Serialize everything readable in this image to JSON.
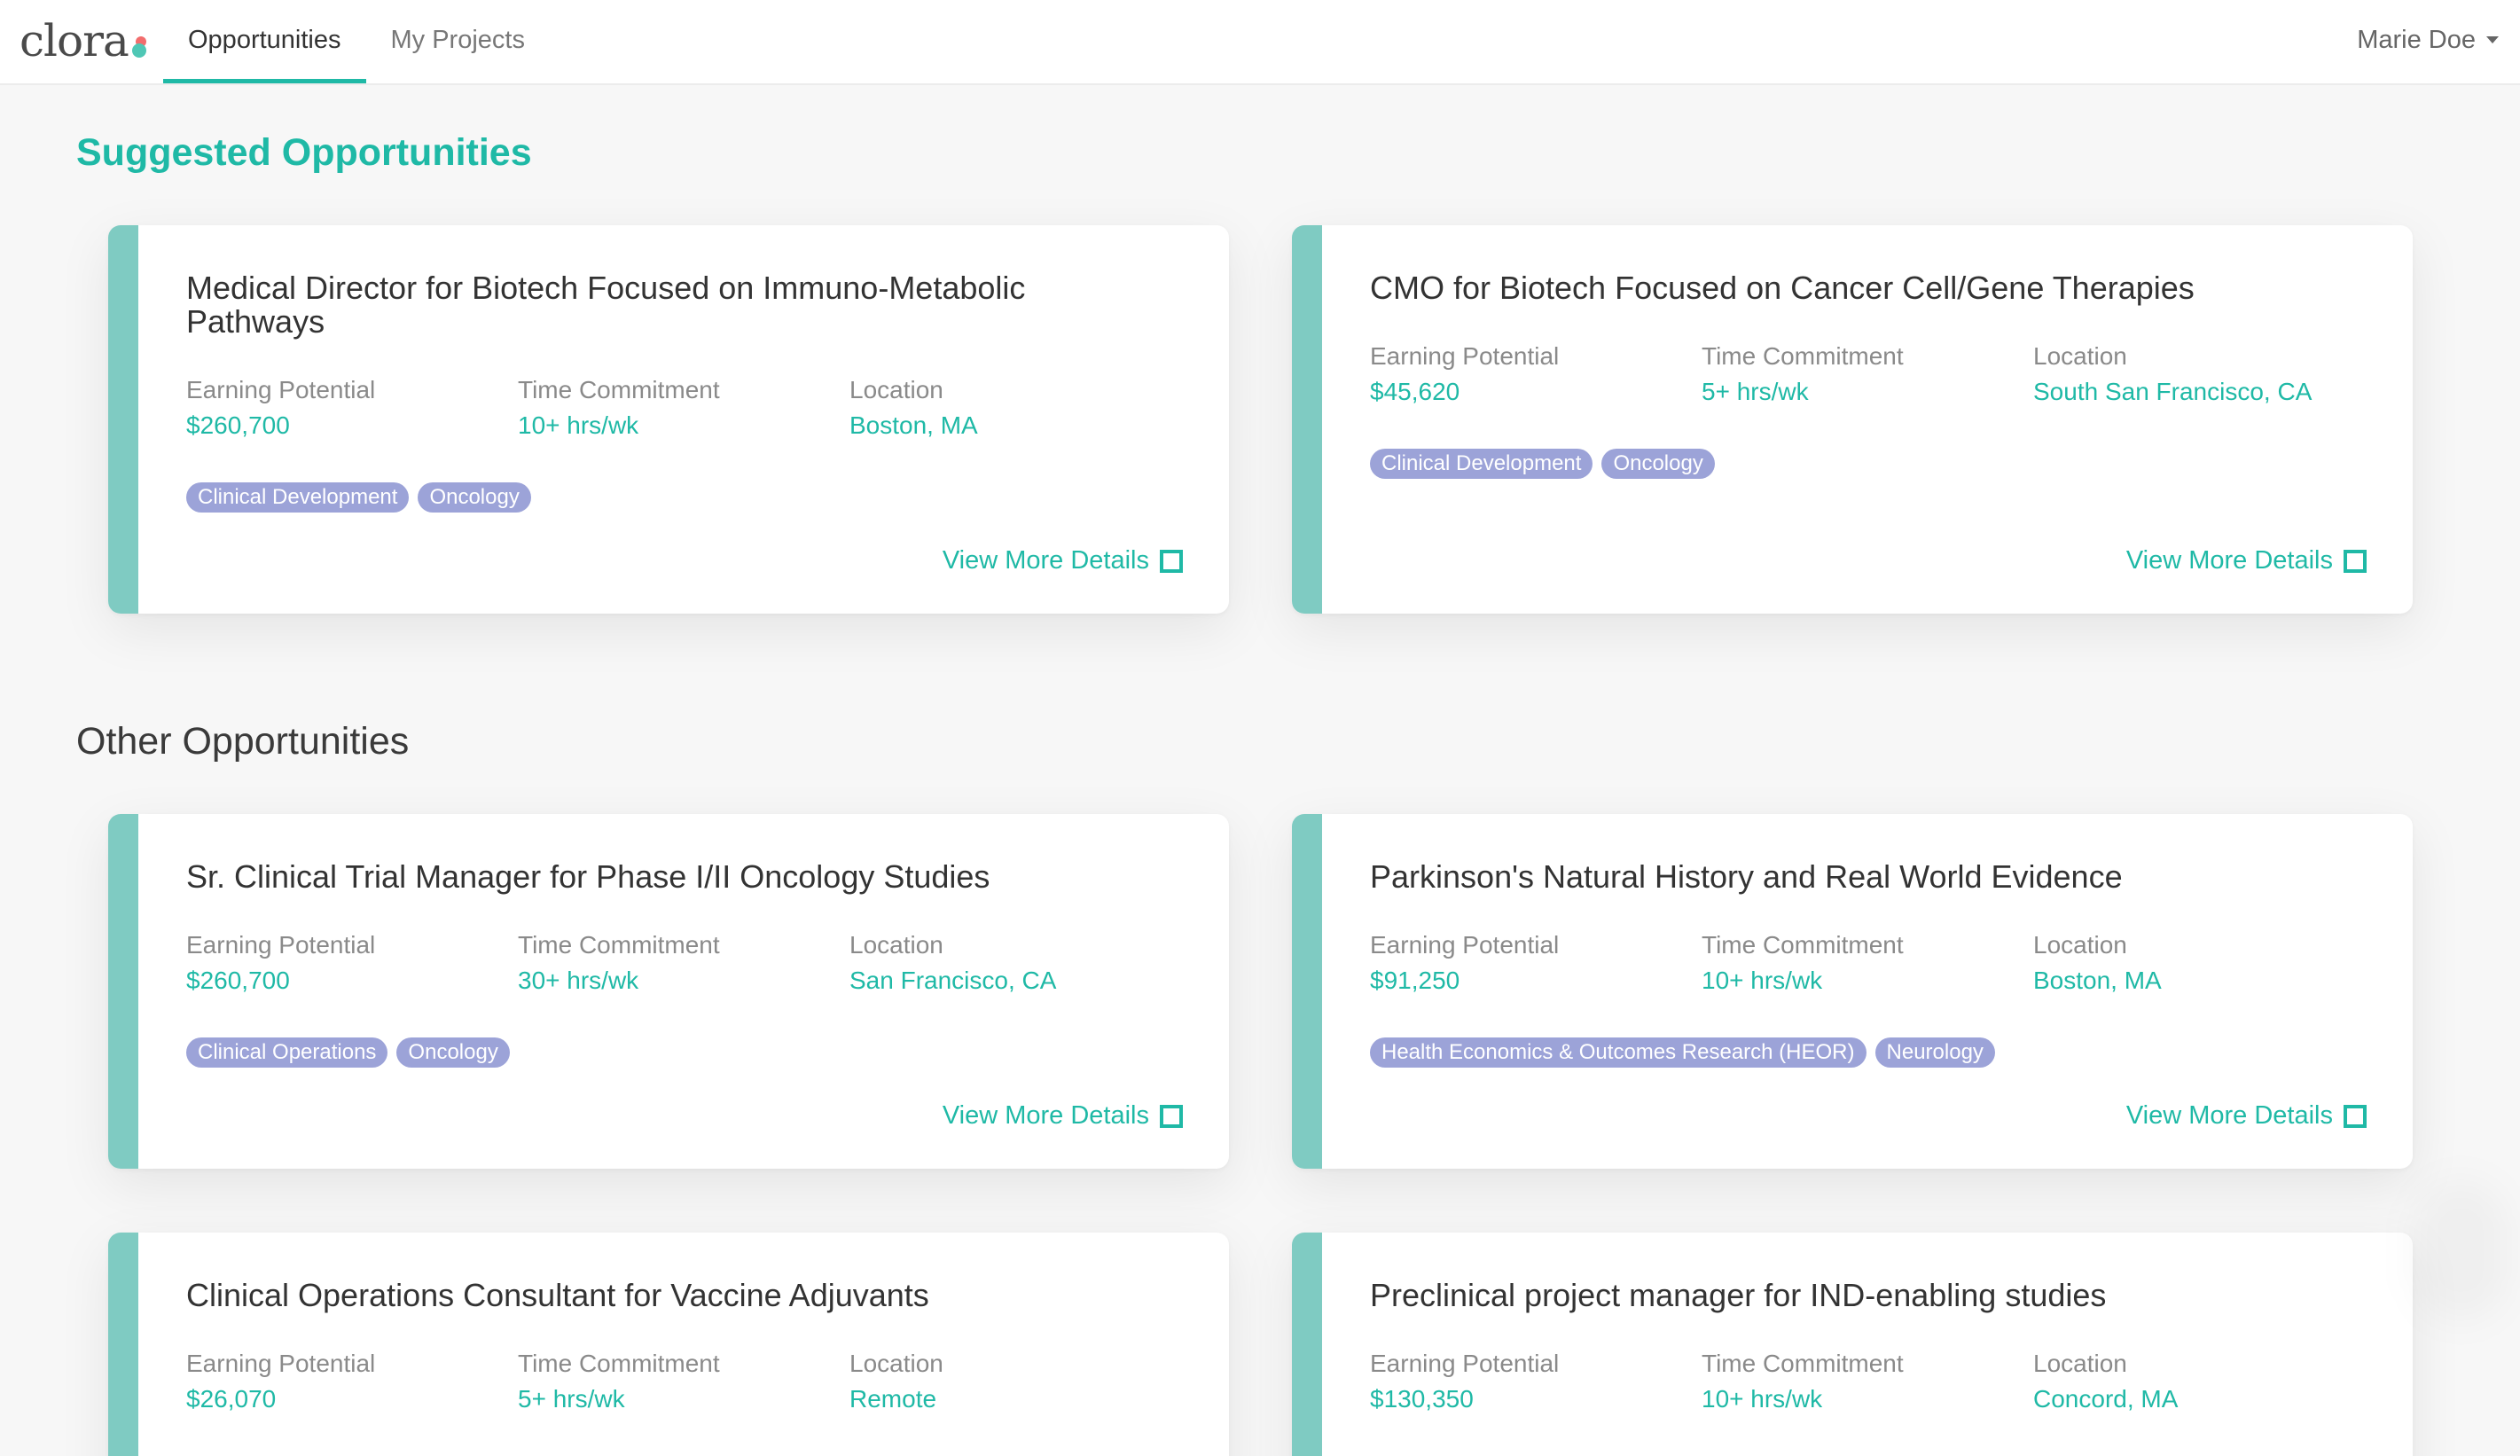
{
  "header": {
    "logo_text": "clora",
    "tabs": [
      {
        "label": "Opportunities",
        "active": true
      },
      {
        "label": "My Projects",
        "active": false
      }
    ],
    "user_name": "Marie Doe"
  },
  "suggested": {
    "title": "Suggested Opportunities",
    "cards": [
      {
        "title": "Medical Director for Biotech Focused on Immuno-Metabolic Pathways",
        "earning_label": "Earning Potential",
        "earning": "$260,700",
        "time_label": "Time Commitment",
        "time": "10+ hrs/wk",
        "location_label": "Location",
        "location": "Boston, MA",
        "tags": [
          "Clinical Development",
          "Oncology"
        ],
        "details_label": "View More Details"
      },
      {
        "title": "CMO for Biotech Focused on Cancer Cell/Gene Therapies",
        "earning_label": "Earning Potential",
        "earning": "$45,620",
        "time_label": "Time Commitment",
        "time": "5+ hrs/wk",
        "location_label": "Location",
        "location": "South San Francisco, CA",
        "tags": [
          "Clinical Development",
          "Oncology"
        ],
        "details_label": "View More Details"
      }
    ]
  },
  "other": {
    "title": "Other Opportunities",
    "cards": [
      {
        "title": "Sr. Clinical Trial Manager for Phase I/II Oncology Studies",
        "earning_label": "Earning Potential",
        "earning": "$260,700",
        "time_label": "Time Commitment",
        "time": "30+ hrs/wk",
        "location_label": "Location",
        "location": "San Francisco, CA",
        "tags": [
          "Clinical Operations",
          "Oncology"
        ],
        "details_label": "View More Details"
      },
      {
        "title": "Parkinson's Natural History and Real World Evidence",
        "earning_label": "Earning Potential",
        "earning": "$91,250",
        "time_label": "Time Commitment",
        "time": "10+ hrs/wk",
        "location_label": "Location",
        "location": "Boston, MA",
        "tags": [
          "Health Economics & Outcomes Research (HEOR)",
          "Neurology"
        ],
        "details_label": "View More Details"
      },
      {
        "title": "Clinical Operations Consultant for Vaccine Adjuvants",
        "earning_label": "Earning Potential",
        "earning": "$26,070",
        "time_label": "Time Commitment",
        "time": "5+ hrs/wk",
        "location_label": "Location",
        "location": "Remote"
      },
      {
        "title": "Preclinical project manager for IND-enabling studies",
        "earning_label": "Earning Potential",
        "earning": "$130,350",
        "time_label": "Time Commitment",
        "time": "10+ hrs/wk",
        "location_label": "Location",
        "location": "Concord, MA"
      }
    ]
  },
  "colors": {
    "accent": "#1fb9a6",
    "card_stripe": "#7fcbc2",
    "tag_bg": "#9ca3d8",
    "page_bg": "#f7f7f7"
  },
  "icons": {
    "expand": "expand-icon",
    "user_caret": "caret-down-icon"
  }
}
